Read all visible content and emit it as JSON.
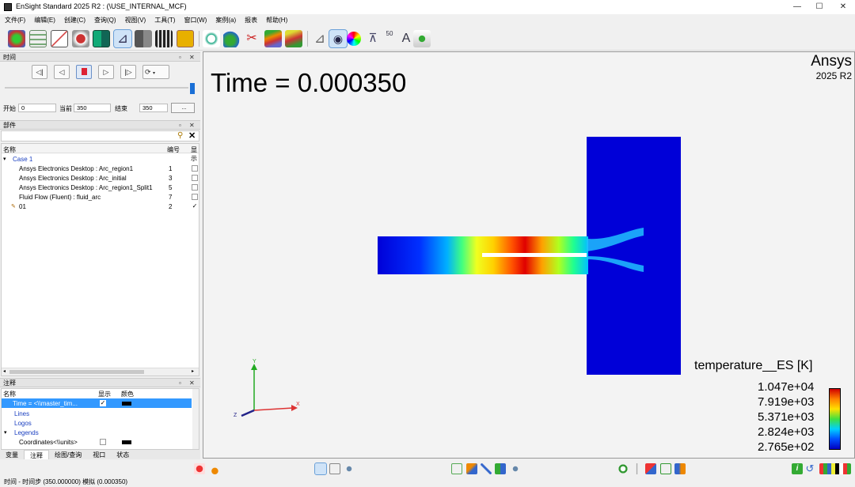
{
  "window": {
    "title": "EnSight Standard 2025 R2 :  (\\USE_INTERNAL_MCF)",
    "minimize": "—",
    "maximize": "☐",
    "close": "✕"
  },
  "menu": [
    "文件(F)",
    "编辑(E)",
    "创建(C)",
    "查询(Q)",
    "视图(V)",
    "工具(T)",
    "窗口(W)",
    "案例(a)",
    "报表",
    "帮助(H)"
  ],
  "toolbar": {
    "text_number": "50",
    "text_letter": "A"
  },
  "time_panel": {
    "title": "时间",
    "start_label": "开始",
    "start_value": "0",
    "current_label": "当前",
    "current_value": "350",
    "end_label": "结束",
    "end_value": "350",
    "more_label": "..."
  },
  "parts_panel": {
    "title": "部件",
    "col_name": "名称",
    "col_id": "编号",
    "col_show": "显示",
    "case": "Case 1",
    "rows": [
      {
        "name": "Ansys Electronics Desktop : Arc_region1",
        "id": "1",
        "shown": false
      },
      {
        "name": "Ansys Electronics Desktop : Arc_initial",
        "id": "3",
        "shown": false
      },
      {
        "name": "Ansys Electronics Desktop : Arc_region1_Split1",
        "id": "5",
        "shown": false
      },
      {
        "name": "Fluid Flow (Fluent) : fluid_arc",
        "id": "7",
        "shown": false
      },
      {
        "name": "01",
        "id": "2",
        "shown": true
      }
    ]
  },
  "annot_panel": {
    "title": "注释",
    "col_name": "名称",
    "col_show": "显示",
    "col_color": "颜色",
    "rows": [
      "Time = <\\\\master_tim...",
      "Lines",
      "Logos",
      "Legends",
      "Coordinates<\\\\units>"
    ]
  },
  "tabs": [
    "变量",
    "注释",
    "绘图/查询",
    "视口",
    "状态"
  ],
  "viewport": {
    "time_text": "Time = 0.000350",
    "brand": "Ansys",
    "version": "2025 R2",
    "axis_labels": [
      "Y",
      "X",
      "Z"
    ],
    "legend": {
      "title": "temperature__ES [K]",
      "values": [
        "1.047e+04",
        "7.919e+03",
        "5.371e+03",
        "2.824e+03",
        "2.765e+02"
      ]
    }
  },
  "status": "时间 - 时间步 (350.000000) 模拟 (0.000350)",
  "colors": {
    "selection": "#3399ff",
    "vessel": "#0000d8"
  }
}
